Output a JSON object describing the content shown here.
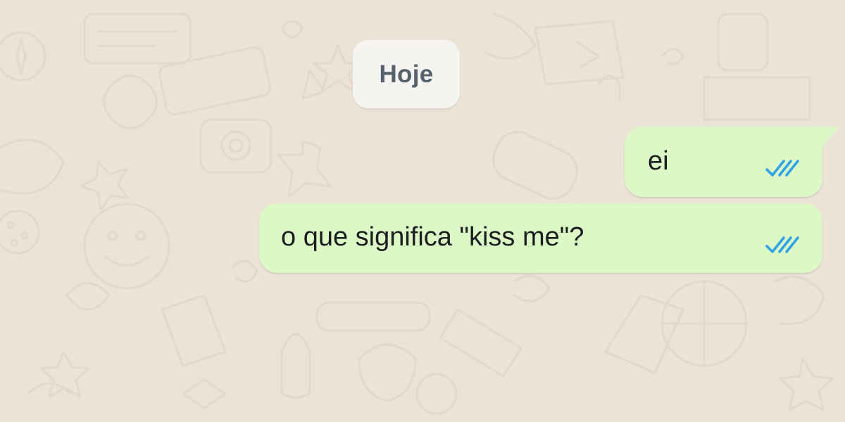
{
  "chat": {
    "date_separator": "Hoje",
    "messages": [
      {
        "text": "ei",
        "direction": "outgoing",
        "status": "read"
      },
      {
        "text": "o que significa \"kiss me\"?",
        "direction": "outgoing",
        "status": "read"
      }
    ]
  },
  "colors": {
    "wallpaper": "#ece3d7",
    "outgoing_bubble": "#ddf8c7",
    "date_chip": "#f6f4f1",
    "read_ticks": "#2fa3e6"
  },
  "icons": {
    "read_receipt": "double-check-icon"
  }
}
